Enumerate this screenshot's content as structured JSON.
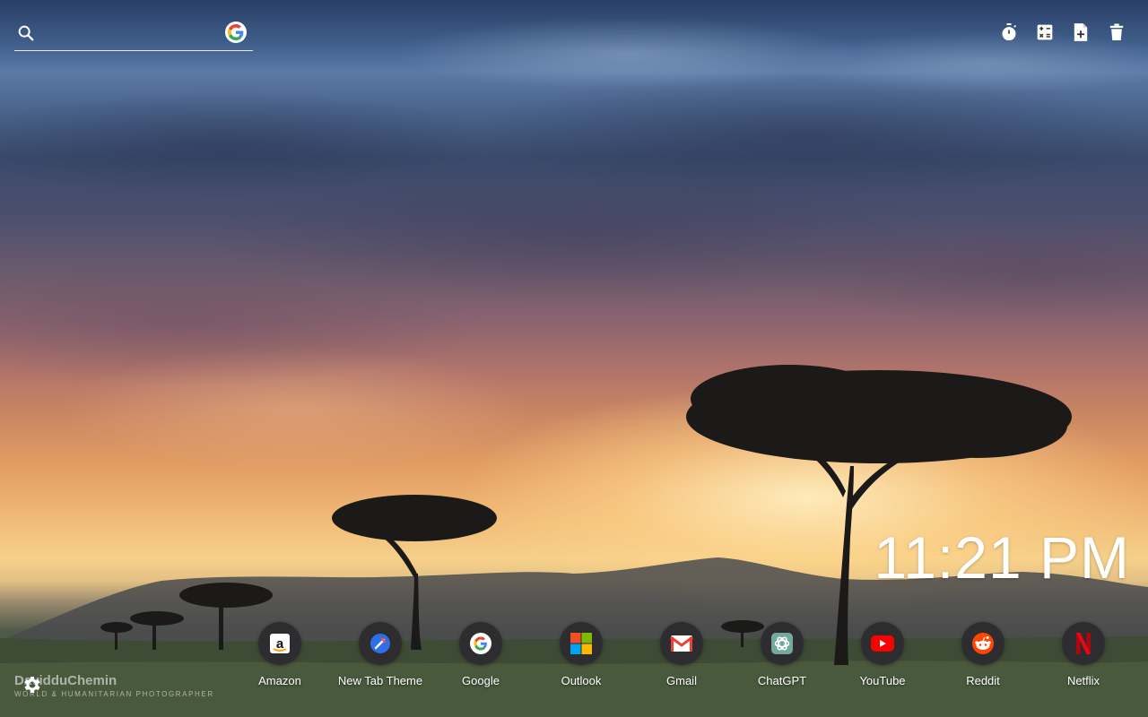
{
  "search": {
    "placeholder": "",
    "icon": "search-icon",
    "engine_icon": "google-icon"
  },
  "toolbar": {
    "items": [
      {
        "name": "timer",
        "icon": "stopwatch-icon"
      },
      {
        "name": "calculator",
        "icon": "calculator-icon"
      },
      {
        "name": "notes",
        "icon": "note-add-icon"
      },
      {
        "name": "delete",
        "icon": "trash-icon"
      }
    ]
  },
  "clock": {
    "time": "11:21 PM"
  },
  "shortcuts": [
    {
      "label": "Amazon",
      "icon": "amazon-icon"
    },
    {
      "label": "New Tab Theme",
      "icon": "new-tab-theme-icon"
    },
    {
      "label": "Google",
      "icon": "google-icon"
    },
    {
      "label": "Outlook",
      "icon": "microsoft-icon"
    },
    {
      "label": "Gmail",
      "icon": "gmail-icon"
    },
    {
      "label": "ChatGPT",
      "icon": "chatgpt-icon"
    },
    {
      "label": "YouTube",
      "icon": "youtube-icon"
    },
    {
      "label": "Reddit",
      "icon": "reddit-icon"
    },
    {
      "label": "Netflix",
      "icon": "netflix-icon"
    }
  ],
  "credit": {
    "name": "DavidduChemin",
    "subtitle": "WORLD & HUMANITARIAN PHOTOGRAPHER"
  },
  "settings": {
    "icon": "gear-icon"
  },
  "colors": {
    "google_blue": "#4285F4",
    "google_red": "#EA4335",
    "google_yellow": "#FBBC05",
    "google_green": "#34A853",
    "youtube_red": "#FF0000",
    "reddit_orange": "#FF4500",
    "netflix_red": "#E50914",
    "chatgpt_teal": "#74AA9C",
    "icon_bg": "#2d2d2f"
  }
}
